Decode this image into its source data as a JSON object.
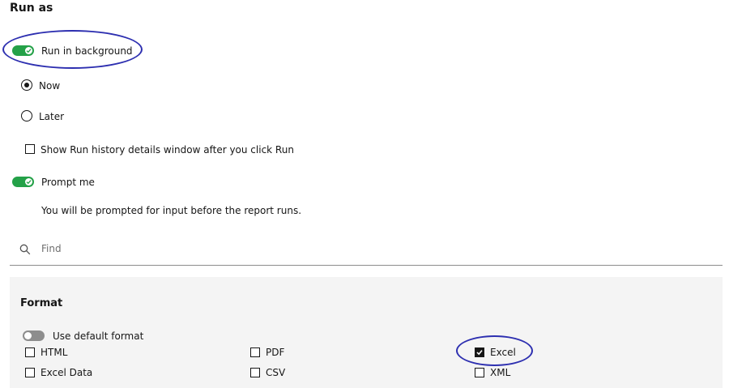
{
  "page": {
    "title": "Run as"
  },
  "run_in_background": {
    "label": "Run in background",
    "on": true
  },
  "timing": {
    "options": [
      {
        "label": "Now",
        "selected": true
      },
      {
        "label": "Later",
        "selected": false
      }
    ]
  },
  "show_history": {
    "label": "Show Run history details window after you click Run",
    "checked": false
  },
  "prompt_me": {
    "label": "Prompt me",
    "on": true,
    "description": "You will be prompted for input before the report runs."
  },
  "search": {
    "placeholder": "Find"
  },
  "format": {
    "title": "Format",
    "use_default": {
      "label": "Use default format",
      "on": false
    },
    "options": [
      {
        "label": "HTML",
        "checked": false
      },
      {
        "label": "PDF",
        "checked": false
      },
      {
        "label": "Excel",
        "checked": true
      },
      {
        "label": "Excel Data",
        "checked": false
      },
      {
        "label": "CSV",
        "checked": false
      },
      {
        "label": "XML",
        "checked": false
      }
    ]
  },
  "colors": {
    "toggle_on": "#24a148",
    "toggle_off": "#8d8d8d",
    "annotation": "#2d2fb0",
    "panel_bg": "#f4f4f4"
  }
}
